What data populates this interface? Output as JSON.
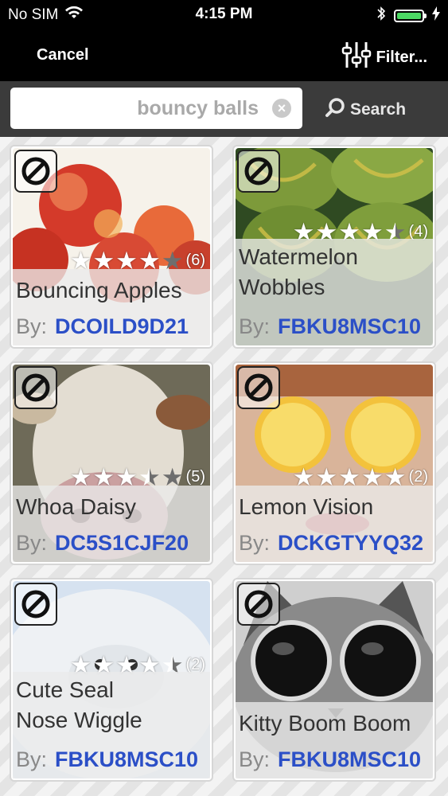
{
  "status_bar": {
    "carrier": "No SIM",
    "time": "4:15 PM"
  },
  "nav": {
    "cancel_label": "Cancel",
    "filter_label": "Filter..."
  },
  "search": {
    "value": "bouncy balls",
    "button_label": "Search"
  },
  "by_label": "By:",
  "cards": [
    {
      "title": "Bouncing Apples",
      "author": "DCOILD9D21",
      "rating": 4,
      "count": "(6)",
      "image": "apples"
    },
    {
      "title": "Watermelon Wobbles",
      "title_line1": "Watermelon",
      "title_line2": "Wobbles",
      "author": "FBKU8MSC10",
      "rating": 4.5,
      "count": "(4)",
      "image": "watermelon"
    },
    {
      "title": "Whoa Daisy",
      "author": "DC5S1CJF20",
      "rating": 3.5,
      "count": "(5)",
      "image": "cow"
    },
    {
      "title": "Lemon Vision",
      "author": "DCKGTYYQ32",
      "rating": 5,
      "count": "(2)",
      "image": "lemons"
    },
    {
      "title": "Cute Seal Nose Wiggle",
      "title_line1": "Cute Seal",
      "title_line2": "Nose Wiggle",
      "author": "FBKU8MSC10",
      "rating": 4.5,
      "count": "(2)",
      "image": "seal"
    },
    {
      "title": "Kitty Boom Boom",
      "author": "FBKU8MSC10",
      "rating": 0,
      "count": "",
      "image": "cat"
    }
  ],
  "colors": {
    "accent": "#2b4fc7",
    "nav_bg": "#000000",
    "search_bar_bg": "#3b3b3b",
    "battery": "#4cd964"
  }
}
